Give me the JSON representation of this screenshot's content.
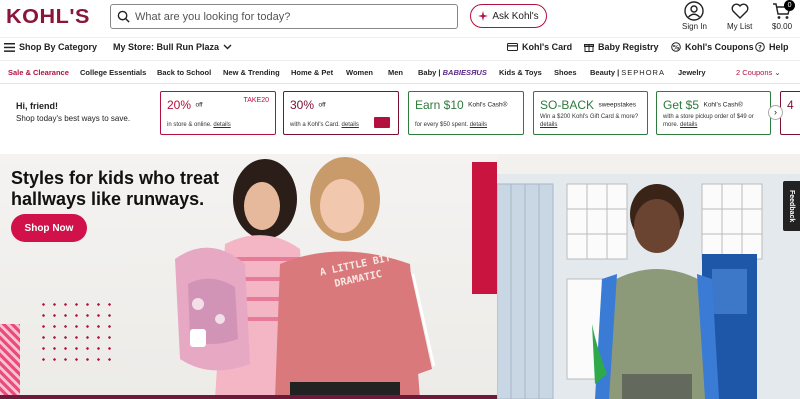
{
  "header": {
    "logo": "KOHL'S",
    "search_placeholder": "What are you looking for today?",
    "ask_label": "Ask Kohl's",
    "signin_label": "Sign In",
    "mylist_label": "My List",
    "cart_label": "$0.00",
    "cart_count": "0"
  },
  "subnav": {
    "shop_by_category": "Shop By Category",
    "my_store": "My Store: Bull Run Plaza",
    "kohls_card": "Kohl's Card",
    "baby_registry": "Baby Registry",
    "kohls_coupons": "Kohl's Coupons",
    "help": "Help"
  },
  "categories": {
    "sale": "Sale & Clearance",
    "college": "College Essentials",
    "back_to_school": "Back to School",
    "new_trending": "New & Trending",
    "home_pet": "Home & Pet",
    "women": "Women",
    "men": "Men",
    "baby": "Baby",
    "babiesrus": "BABIESЯUS",
    "kids_toys": "Kids & Toys",
    "shoes": "Shoes",
    "beauty": "Beauty",
    "sephora": "SEPHORA",
    "jewelry": "Jewelry",
    "coupons": "2 Coupons"
  },
  "greeting": {
    "line1": "Hi, friend!",
    "line2": "Shop today's best ways to save."
  },
  "promos": [
    {
      "big": "20%",
      "small": "off",
      "code": "TAKE20",
      "desc": "in store & online.",
      "link": "details"
    },
    {
      "big": "30%",
      "small": "off",
      "desc": "with a Kohl's Card.",
      "link": "details"
    },
    {
      "big": "Earn $10",
      "small": "Kohl's Cash®",
      "desc": "for every $50 spent.",
      "link": "details"
    },
    {
      "big": "SO-BACK",
      "small": "sweepstakes",
      "desc": "Win a $200 Kohl's Gift Card & more?",
      "link": "details"
    },
    {
      "big": "Get $5",
      "small": "Kohl's Cash®",
      "desc": "with a store pickup order of $49 or more.",
      "link": "details"
    },
    {
      "big": "4"
    }
  ],
  "hero": {
    "title_line1": "Styles for kids who treat",
    "title_line2": "hallways like runways.",
    "cta": "Shop Now",
    "sweatshirt_text": "A LITTLE BIT DRAMATIC"
  },
  "feedback_label": "Feedback",
  "colors": {
    "brand": "#8a1538",
    "accent": "#d0114a",
    "green": "#2f7a3d"
  }
}
